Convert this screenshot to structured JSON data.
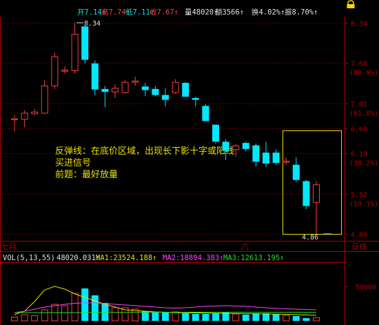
{
  "header": {
    "open": "开7.14↑",
    "high": "高7.74↑",
    "low": "低7.11↑",
    "close": "收7.67↑",
    "volume": "量48020↑",
    "amount": "额3566↑",
    "turnover": "换4.02%↑",
    "amplitude": "振8.70%↑"
  },
  "annotation": {
    "line1": "反弹线：在底价区域，出现长下影十字或阳线",
    "line2": "买进信号",
    "line3": "前题：最好放量"
  },
  "volume_header": {
    "indicator": "VOL(5,13,55)",
    "vol": "48020.031↑",
    "ma1": "MA1:23524.188↑",
    "ma2": "MA2:18894.383↑",
    "ma3": "MA3:12613.195↑"
  },
  "colors": {
    "up": "#ff3c3c",
    "down": "#00e8ff",
    "frame": "#b00000",
    "annotation": "#e8e000"
  },
  "chart_data": {
    "type": "candlestick",
    "period": "日线",
    "dates": [
      "七月",
      "六"
    ],
    "price": {
      "ylim": [
        4.86,
        8.34
      ],
      "high_label": "8.34",
      "low_label": "4.86",
      "ticks": [
        {
          "value": 8.34,
          "label": "8.34",
          "pct": ""
        },
        {
          "value": 7.68,
          "label": "7.68",
          "pct": "(80.9%)"
        },
        {
          "value": 7.01,
          "label": "7.01",
          "pct": "(61.8%)"
        },
        {
          "value": 6.6,
          "label": "6.60",
          "pct": ""
        },
        {
          "value": 6.19,
          "label": "6.19",
          "pct": "(38.2%)"
        },
        {
          "value": 5.52,
          "label": "5.52",
          "pct": "(19.1%)"
        },
        {
          "value": 4.86,
          "label": "4.86",
          "pct": ""
        }
      ]
    },
    "candles": [
      {
        "o": 6.75,
        "h": 6.82,
        "l": 6.55,
        "c": 6.75
      },
      {
        "o": 6.75,
        "h": 6.9,
        "l": 6.62,
        "c": 6.85
      },
      {
        "o": 6.85,
        "h": 6.92,
        "l": 6.82,
        "c": 6.86
      },
      {
        "o": 6.85,
        "h": 7.4,
        "l": 6.84,
        "c": 7.3
      },
      {
        "o": 7.3,
        "h": 7.85,
        "l": 7.25,
        "c": 7.78
      },
      {
        "o": 7.55,
        "h": 7.62,
        "l": 7.5,
        "c": 7.55
      },
      {
        "o": 7.55,
        "h": 8.34,
        "l": 7.5,
        "c": 8.15
      },
      {
        "o": 8.28,
        "h": 8.3,
        "l": 7.67,
        "c": 7.73
      },
      {
        "o": 7.67,
        "h": 7.72,
        "l": 7.14,
        "c": 7.24
      },
      {
        "o": 7.25,
        "h": 7.3,
        "l": 6.95,
        "c": 7.2
      },
      {
        "o": 7.2,
        "h": 7.32,
        "l": 7.1,
        "c": 7.26
      },
      {
        "o": 7.19,
        "h": 7.4,
        "l": 7.17,
        "c": 7.36
      },
      {
        "o": 7.37,
        "h": 7.45,
        "l": 7.3,
        "c": 7.37
      },
      {
        "o": 7.29,
        "h": 7.35,
        "l": 7.13,
        "c": 7.23
      },
      {
        "o": 7.25,
        "h": 7.3,
        "l": 7.13,
        "c": 7.15
      },
      {
        "o": 7.15,
        "h": 7.26,
        "l": 6.96,
        "c": 7.07
      },
      {
        "o": 7.19,
        "h": 7.41,
        "l": 7.17,
        "c": 7.36
      },
      {
        "o": 7.35,
        "h": 7.36,
        "l": 7.12,
        "c": 7.12
      },
      {
        "o": 7.1,
        "h": 7.12,
        "l": 6.96,
        "c": 7.07
      },
      {
        "o": 6.97,
        "h": 7.0,
        "l": 6.72,
        "c": 6.72
      },
      {
        "o": 6.66,
        "h": 6.66,
        "l": 6.35,
        "c": 6.38
      },
      {
        "o": 6.38,
        "h": 6.42,
        "l": 6.08,
        "c": 6.23
      },
      {
        "o": 6.25,
        "h": 6.34,
        "l": 6.13,
        "c": 6.31
      },
      {
        "o": 6.36,
        "h": 6.38,
        "l": 6.22,
        "c": 6.26
      },
      {
        "o": 6.32,
        "h": 6.35,
        "l": 5.97,
        "c": 6.05
      },
      {
        "o": 6.2,
        "h": 6.38,
        "l": 5.96,
        "c": 6.02
      },
      {
        "o": 6.2,
        "h": 6.25,
        "l": 6.0,
        "c": 6.03
      },
      {
        "o": 6.05,
        "h": 6.12,
        "l": 6.0,
        "c": 6.05
      },
      {
        "o": 6.0,
        "h": 6.12,
        "l": 5.72,
        "c": 5.75
      },
      {
        "o": 5.73,
        "h": 5.75,
        "l": 5.27,
        "c": 5.32
      },
      {
        "o": 5.38,
        "h": 5.73,
        "l": 4.86,
        "c": 5.67
      }
    ],
    "volume": {
      "ylim": [
        0,
        75000
      ],
      "ticks": [
        50000
      ],
      "values": [
        5500,
        9000,
        7500,
        16000,
        24000,
        22000,
        40000,
        47000,
        37000,
        26000,
        19000,
        19000,
        17000,
        14000,
        12000,
        13000,
        13000,
        11000,
        10000,
        10000,
        11000,
        12000,
        10000,
        9000,
        11000,
        11000,
        10000,
        8000,
        7000,
        4000,
        4500
      ],
      "ma5": [
        9000,
        14000,
        28000,
        45000,
        50000,
        46000,
        39000,
        34000,
        29000,
        24000,
        20000,
        16000,
        15000,
        14000,
        13000,
        12500,
        12000,
        11800,
        11500,
        11300,
        11000,
        10800,
        10600,
        10400,
        10200,
        10000,
        9800,
        9500,
        9000,
        8500,
        8000
      ],
      "ma13": [
        12000,
        14000,
        17000,
        20000,
        22000,
        24000,
        25500,
        26000,
        26000,
        25000,
        24000,
        23000,
        22000,
        21000,
        20000,
        19000,
        18500,
        19000,
        20000,
        21000,
        21500,
        22000,
        21500,
        21000,
        20000,
        19000,
        18000,
        17500,
        17000,
        16500,
        16000
      ],
      "ma55": [
        12000,
        12000,
        12000,
        12000,
        12000,
        12000,
        12000,
        12100,
        12200,
        12200,
        12300,
        12400,
        12400,
        12400,
        12500,
        12500,
        12500,
        12500,
        12500,
        12500,
        12500,
        12500,
        12500,
        12500,
        12500,
        12500,
        12500,
        12500,
        12500,
        12500,
        12500
      ]
    }
  }
}
